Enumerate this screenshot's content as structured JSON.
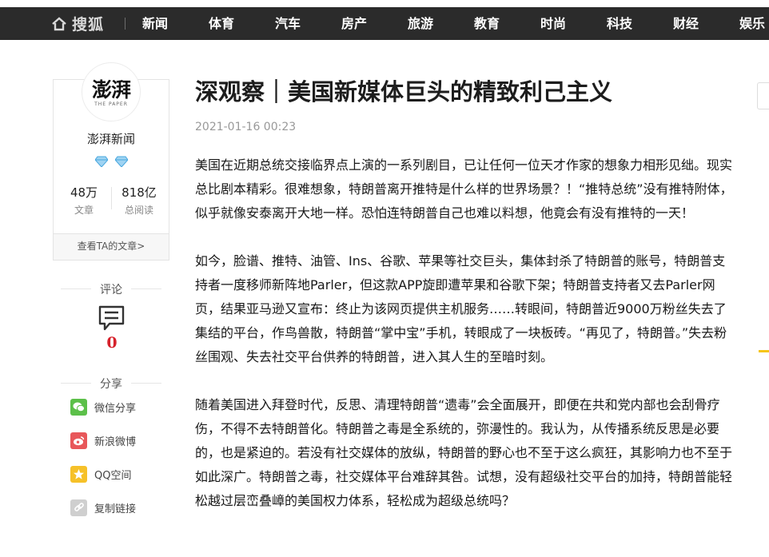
{
  "nav": {
    "logo_text": "搜狐",
    "items": [
      "新闻",
      "体育",
      "汽车",
      "房产",
      "旅游",
      "教育",
      "时尚",
      "科技",
      "财经",
      "娱乐"
    ]
  },
  "author": {
    "logo_text": "澎湃",
    "logo_subtext": "THE PAPER",
    "name": "澎湃新闻",
    "articles_count": "48万",
    "articles_label": "文章",
    "reads_count": "818亿",
    "reads_label": "总阅读",
    "view_more": "查看TA的文章>"
  },
  "comments": {
    "heading": "评论",
    "count": "0"
  },
  "share": {
    "heading": "分享",
    "items": [
      {
        "label": "微信分享",
        "icon": "wechat-icon",
        "color": "#5cc04a"
      },
      {
        "label": "新浪微博",
        "icon": "weibo-icon",
        "color": "#e8575a"
      },
      {
        "label": "QQ空间",
        "icon": "qzone-icon",
        "color": "#f6c129"
      },
      {
        "label": "复制链接",
        "icon": "link-icon",
        "color": "#cfcfcf"
      }
    ]
  },
  "article": {
    "title": "深观察｜美国新媒体巨头的精致利己主义",
    "time": "2021-01-16 00:23",
    "paragraphs": [
      "美国在近期总统交接临界点上演的一系列剧目，已让任何一位天才作家的想象力相形见绌。现实总比剧本精彩。很难想象，特朗普离开推特是什么样的世界场景？！“推特总统”没有推特附体，似乎就像安泰离开大地一样。恐怕连特朗普自己也难以料想，他竟会有没有推特的一天！",
      "如今，脸谱、推特、油管、Ins、谷歌、苹果等社交巨头，集体封杀了特朗普的账号，特朗普支持者一度移师新阵地Parler，但这款APP旋即遭苹果和谷歌下架；特朗普支持者又去Parler网页，结果亚马逊又宣布：终止为该网页提供主机服务……转眼间，特朗普近9000万粉丝失去了集结的平台，作鸟兽散，特朗普“掌中宝”手机，转眼成了一块板砖。“再见了，特朗普。”失去粉丝围观、失去社交平台供养的特朗普，进入其人生的至暗时刻。",
      "随着美国进入拜登时代，反思、清理特朗普“遗毒”会全面展开，即便在共和党内部也会刮骨疗伤，不得不去特朗普化。特朗普之毒是全系统的，弥漫性的。我认为，从传播系统反思是必要的，也是紧迫的。若没有社交媒体的放纵，特朗普的野心也不至于这么疯狂，其影响力也不至于如此深广。特朗普之毒，社交媒体平台难辞其咎。试想，没有超级社交平台的加持，特朗普能轻松越过层峦叠嶂的美国权力体系，轻松成为超级总统吗？"
    ]
  }
}
